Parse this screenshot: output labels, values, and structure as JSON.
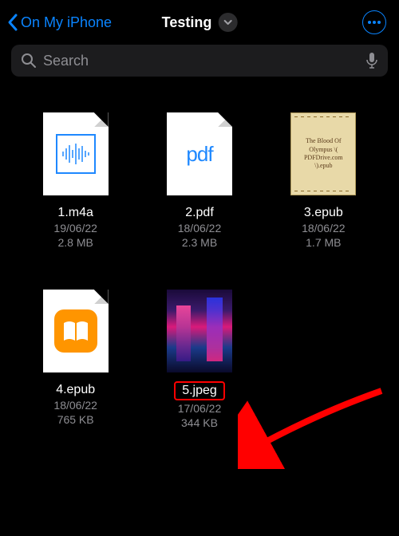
{
  "nav": {
    "back_label": "On My iPhone",
    "title": "Testing",
    "search_placeholder": "Search"
  },
  "files": [
    {
      "name": "1.m4a",
      "date": "19/06/22",
      "size": "2.8 MB",
      "kind": "audio",
      "highlighted": false
    },
    {
      "name": "2.pdf",
      "date": "18/06/22",
      "size": "2.3 MB",
      "kind": "pdf",
      "highlighted": false
    },
    {
      "name": "3.epub",
      "date": "18/06/22",
      "size": "1.7 MB",
      "kind": "epub-cover",
      "highlighted": false,
      "cover_lines": [
        "The Blood Of",
        "Olympus \\(",
        "PDFDrive.com",
        "\\).epub"
      ]
    },
    {
      "name": "4.epub",
      "date": "18/06/22",
      "size": "765 KB",
      "kind": "ibooks",
      "highlighted": false
    },
    {
      "name": "5.jpeg",
      "date": "17/06/22",
      "size": "344 KB",
      "kind": "jpeg",
      "highlighted": true
    }
  ],
  "icons": {
    "pdf_label": "pdf"
  }
}
